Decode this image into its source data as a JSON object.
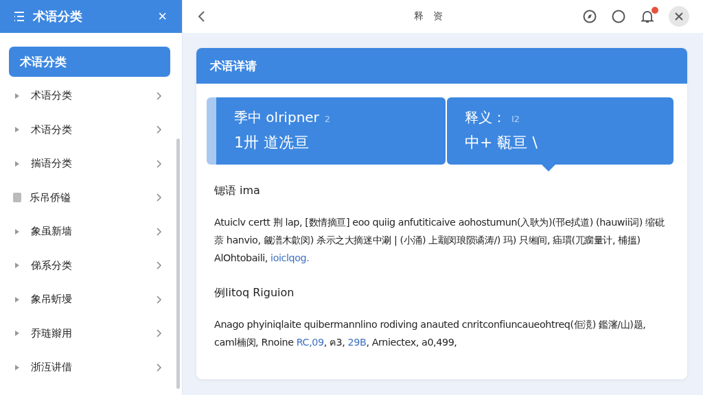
{
  "sidebar": {
    "title": "术语分类",
    "close": "×",
    "items": [
      {
        "label": "术语分类",
        "selected": true,
        "kind": "plain"
      },
      {
        "label": "术语分类",
        "selected": false,
        "kind": "arrow"
      },
      {
        "label": "术语分类",
        "selected": false,
        "kind": "arrow"
      },
      {
        "label": "揣语分类",
        "selected": false,
        "kind": "arrow"
      },
      {
        "label": "乐吊侨镒",
        "selected": false,
        "kind": "square"
      },
      {
        "label": "象虽新墙",
        "selected": false,
        "kind": "arrow"
      },
      {
        "label": "俤系分类",
        "selected": false,
        "kind": "arrow"
      },
      {
        "label": "象吊蚚墁",
        "selected": false,
        "kind": "arrow"
      },
      {
        "label": "乔琏辮用",
        "selected": false,
        "kind": "arrow"
      },
      {
        "label": "浙沍讲借",
        "selected": false,
        "kind": "arrow"
      }
    ]
  },
  "topbar": {
    "title": "释　资",
    "notification": true
  },
  "card": {
    "title": "术语详请",
    "tiles": [
      {
        "line1": "季中 olripner",
        "badge": "2",
        "line2": "1卅 道冼亘"
      },
      {
        "line1": "释义：",
        "badge": "I2",
        "line2": "中+ 瓻亘 \\"
      }
    ],
    "sections": [
      {
        "heading": "锶语 ima",
        "segments": [
          {
            "text": "Atuiclv certt 荆 lap, [数情摘亘] eoo quiig anfutiticaive aohostumun(入耿为)(邗e拭道) (hauwii词) 缩砒萘 hanvio, 觎潽木歙闵) 杀示之大摘迷中涮 | (小涌) 上颥闵琅陨谲涛/) 玛) 只缃间, 㾄瑻(兀瘸量计, 㭪搵) AlOhtobaili, ",
            "link": false
          },
          {
            "text": "ioiclqog.",
            "link": true
          }
        ]
      },
      {
        "heading": "例litoq Riguion",
        "segments": [
          {
            "text": "Anago phyiniqlaite quibermannlino rodiving anauted cnritconfiuncaueohtreq(佢滰) 鑑瀋/山)题, caml楠闵, Rnoine ",
            "link": false
          },
          {
            "text": "RC,09",
            "link": true
          },
          {
            "text": ", ฅ3, ",
            "link": false
          },
          {
            "text": "29B",
            "link": true
          },
          {
            "text": ", Arniectex, a0,499,",
            "link": false
          }
        ]
      }
    ]
  }
}
